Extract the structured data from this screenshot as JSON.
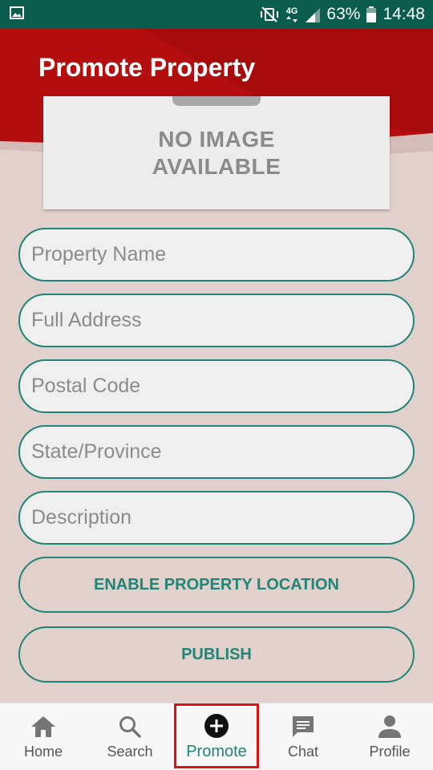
{
  "status_bar": {
    "network": "4G",
    "battery": "63%",
    "time": "14:48"
  },
  "header": {
    "title": "Promote Property",
    "accent_color": "#b50e0e"
  },
  "image_placeholder": {
    "line1": "NO IMAGE",
    "line2": "AVAILABLE"
  },
  "form": {
    "fields": [
      {
        "placeholder": "Property Name",
        "value": ""
      },
      {
        "placeholder": "Full Address",
        "value": ""
      },
      {
        "placeholder": "Postal Code",
        "value": ""
      },
      {
        "placeholder": "State/Province",
        "value": ""
      },
      {
        "placeholder": "Description",
        "value": ""
      }
    ],
    "location_button": "ENABLE PROPERTY LOCATION",
    "publish_button": "PUBLISH"
  },
  "bottom_nav": {
    "items": [
      {
        "label": "Home",
        "icon": "home-icon"
      },
      {
        "label": "Search",
        "icon": "search-icon"
      },
      {
        "label": "Promote",
        "icon": "add-circle-icon",
        "active": true
      },
      {
        "label": "Chat",
        "icon": "chat-icon"
      },
      {
        "label": "Profile",
        "icon": "person-icon"
      }
    ]
  },
  "colors": {
    "status_bar": "#0a5c4c",
    "primary_teal": "#1f8576",
    "background": "#e2d0cc",
    "highlight": "#e01010"
  }
}
